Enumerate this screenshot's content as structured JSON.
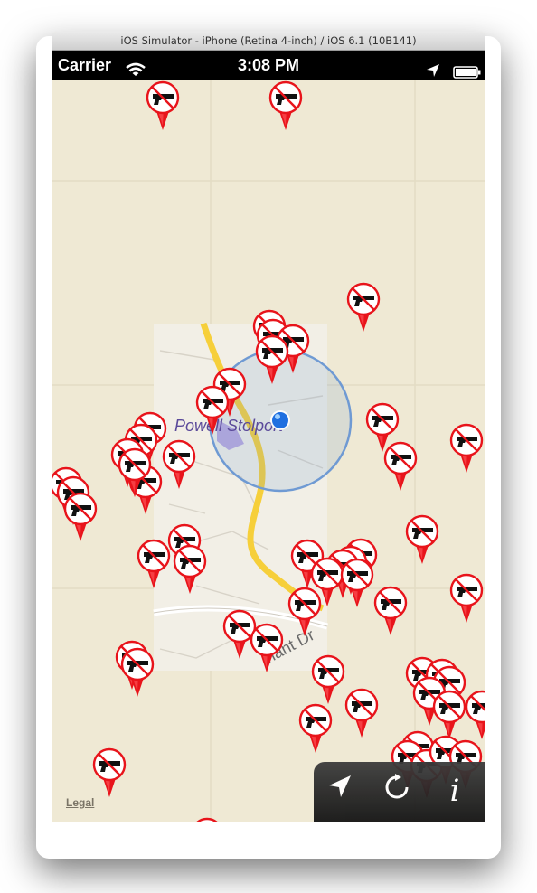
{
  "window": {
    "title": "iOS Simulator - iPhone (Retina 4-inch) / iOS 6.1 (10B141)"
  },
  "status_bar": {
    "carrier": "Carrier",
    "time": "3:08 PM"
  },
  "map": {
    "place_label": "Powell Stolport",
    "street_label": "nant Dr",
    "legal_link": "Legal",
    "pin_icon": "no-guns-icon",
    "user_location_icon": "blue-dot",
    "pin_color": "#e8141b",
    "accuracy_circle_color": "#6f9ad3",
    "road_color": "#f6cf3a"
  },
  "toolbar": {
    "locate_icon": "location-arrow-icon",
    "refresh_icon": "refresh-icon",
    "info_label": "i"
  }
}
